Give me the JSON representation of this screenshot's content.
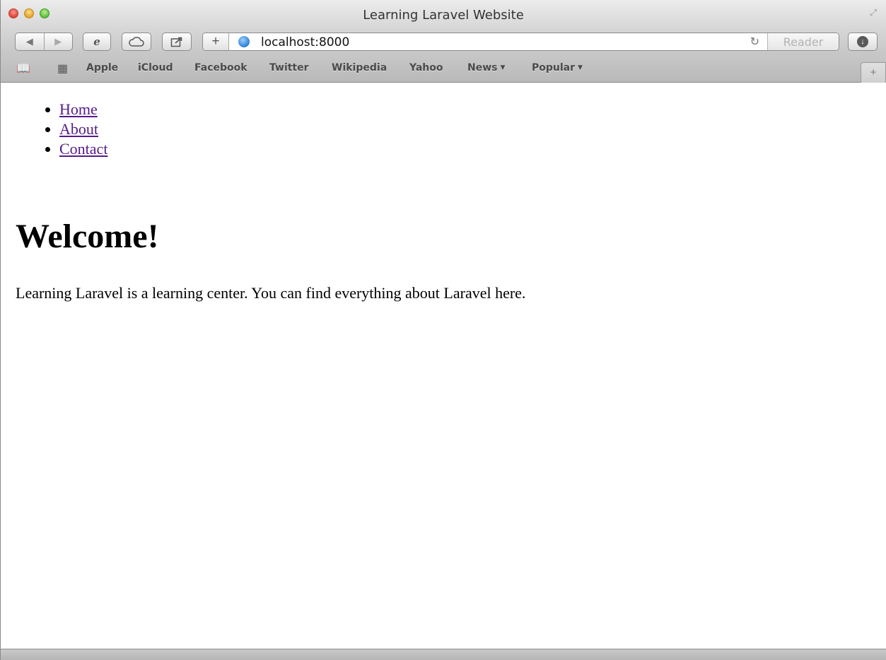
{
  "window": {
    "title": "Learning Laravel Website"
  },
  "toolbar": {
    "back_icon": "back-arrow-icon",
    "forward_icon": "forward-arrow-icon",
    "url": "localhost:8000",
    "reader_label": "Reader"
  },
  "bookmarks": {
    "items": [
      {
        "label": "Apple"
      },
      {
        "label": "iCloud"
      },
      {
        "label": "Facebook"
      },
      {
        "label": "Twitter"
      },
      {
        "label": "Wikipedia"
      },
      {
        "label": "Yahoo"
      },
      {
        "label": "News"
      },
      {
        "label": "Popular"
      }
    ]
  },
  "page": {
    "nav": [
      {
        "label": "Home"
      },
      {
        "label": "About"
      },
      {
        "label": "Contact"
      }
    ],
    "heading": "Welcome!",
    "intro": "Learning Laravel is a learning center. You can find everything about Laravel here."
  },
  "colors": {
    "link": "#551a8b",
    "close": "#e0443e",
    "minimize": "#e2a32a",
    "maximize": "#5fbf3a"
  }
}
